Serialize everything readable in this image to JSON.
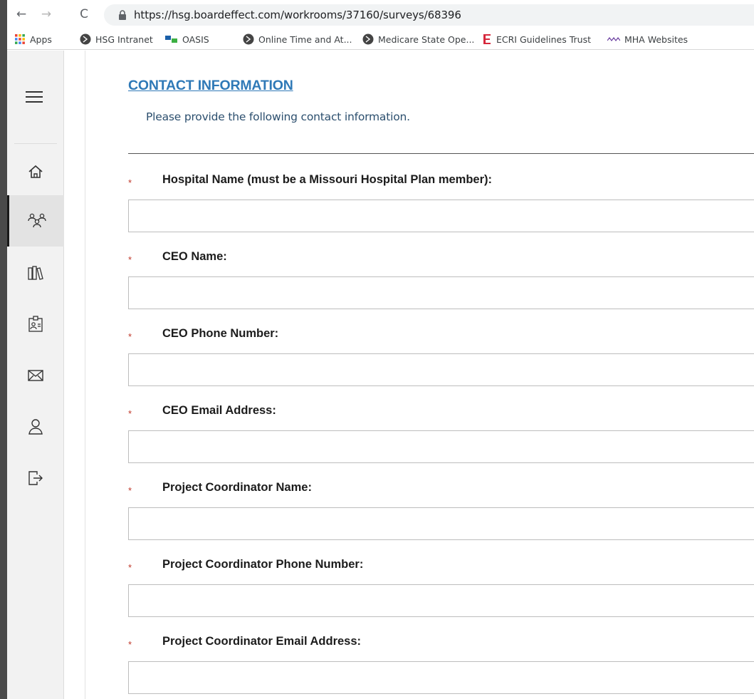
{
  "browser": {
    "url": "https://hsg.boardeffect.com/workrooms/37160/surveys/68396",
    "back_icon": "←",
    "forward_icon": "→",
    "reload_icon": "C"
  },
  "bookmarks": [
    {
      "label": "Apps",
      "icon": "apps-grid-icon"
    },
    {
      "label": "HSG Intranet",
      "icon": "globe-icon"
    },
    {
      "label": "OASIS",
      "icon": "oasis-logo-icon"
    },
    {
      "label": "Online Time and At...",
      "icon": "globe-icon"
    },
    {
      "label": "Medicare State Ope...",
      "icon": "globe-icon"
    },
    {
      "label": "ECRI Guidelines Trust",
      "icon": "ecri-logo-icon"
    },
    {
      "label": "MHA Websites",
      "icon": "mha-logo-icon"
    }
  ],
  "sidebar": {
    "items": [
      {
        "name": "home",
        "icon": "home-icon"
      },
      {
        "name": "workrooms",
        "icon": "group-icon",
        "active": true
      },
      {
        "name": "library",
        "icon": "books-icon"
      },
      {
        "name": "directory",
        "icon": "contact-card-icon"
      },
      {
        "name": "messages",
        "icon": "envelope-icon"
      },
      {
        "name": "profile",
        "icon": "user-icon"
      },
      {
        "name": "logout",
        "icon": "logout-icon"
      }
    ]
  },
  "form": {
    "section_title": "CONTACT INFORMATION",
    "section_description": "Please provide the following contact information.",
    "required_marker": "*",
    "fields": [
      {
        "label": "Hospital Name (must be a Missouri Hospital Plan member):",
        "value": ""
      },
      {
        "label": "CEO Name:",
        "value": ""
      },
      {
        "label": "CEO Phone Number:",
        "value": ""
      },
      {
        "label": "CEO Email Address:",
        "value": ""
      },
      {
        "label": "Project Coordinator Name:",
        "value": ""
      },
      {
        "label": "Project Coordinator Phone Number:",
        "value": ""
      },
      {
        "label": "Project Coordinator Email Address:",
        "value": ""
      }
    ]
  },
  "colors": {
    "title": "#2f79b7",
    "required": "#c0392b",
    "sidebar_bg": "#f2f2f2"
  }
}
